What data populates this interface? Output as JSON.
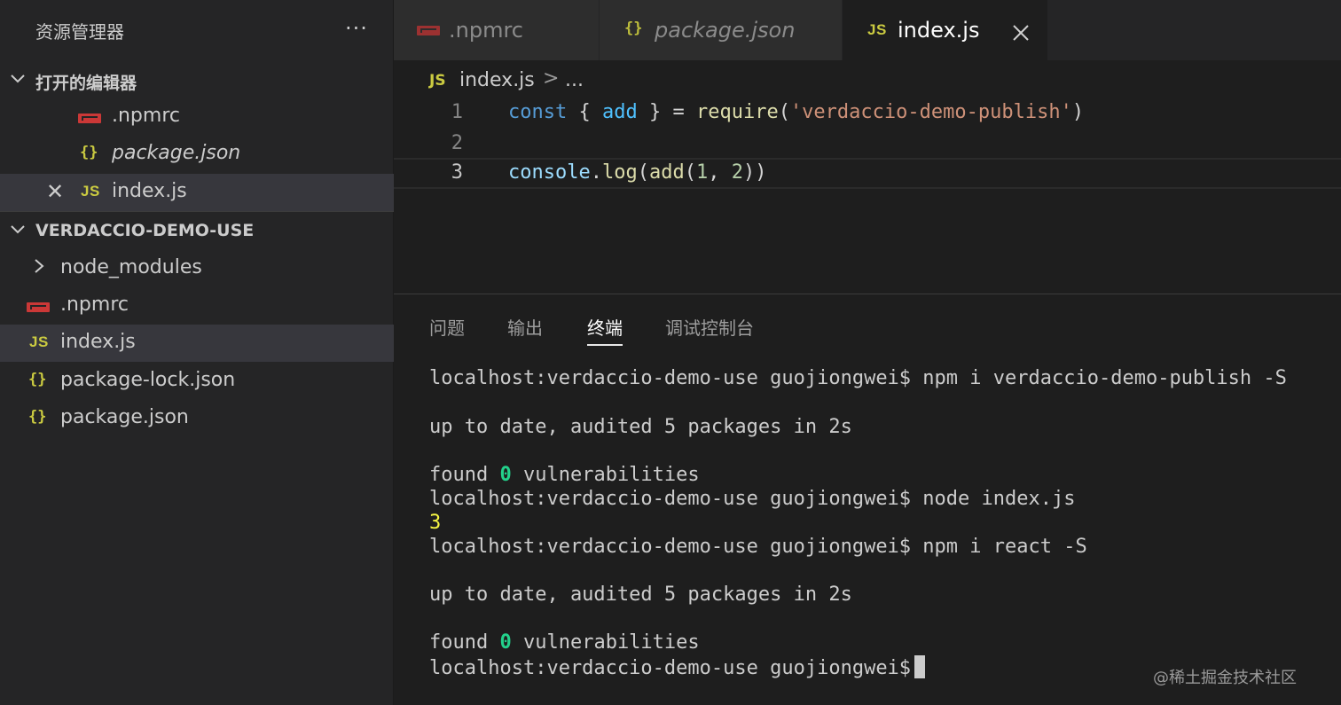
{
  "sidebar": {
    "title": "资源管理器",
    "more": "···",
    "open_editors": {
      "header": "打开的编辑器",
      "items": [
        {
          "label": ".npmrc",
          "icon": "npm-icon"
        },
        {
          "label": "package.json",
          "icon": "{}"
        },
        {
          "label": "index.js",
          "icon": "JS"
        }
      ]
    },
    "workspace": {
      "header": "VERDACCIO-DEMO-USE",
      "items": [
        {
          "label": "node_modules",
          "type": "folder"
        },
        {
          "label": ".npmrc",
          "icon": "npm-icon"
        },
        {
          "label": "index.js",
          "icon": "JS"
        },
        {
          "label": "package-lock.json",
          "icon": "{}"
        },
        {
          "label": "package.json",
          "icon": "{}"
        }
      ]
    }
  },
  "tabs": [
    {
      "label": ".npmrc",
      "icon": "npm-icon",
      "active": false
    },
    {
      "label": "package.json",
      "icon": "{}",
      "active": false,
      "italic": true
    },
    {
      "label": "index.js",
      "icon": "JS",
      "active": true
    }
  ],
  "editor": {
    "breadcrumb": {
      "icon": "JS",
      "file": "index.js",
      "sep": ">",
      "more": "..."
    },
    "line_numbers": [
      "1",
      "2",
      "3"
    ],
    "line1": {
      "t1": "const",
      "t2": " { ",
      "t3": "add",
      "t4": " } = ",
      "t5": "require",
      "t6": "(",
      "t7": "'verdaccio-demo-publish'",
      "t8": ")"
    },
    "line3": {
      "t1": "console",
      "t2": ".",
      "t3": "log",
      "t4": "(",
      "t5": "add",
      "t6": "(",
      "t7": "1",
      "t8": ", ",
      "t9": "2",
      "t10": "))"
    }
  },
  "panel": {
    "tabs": [
      "问题",
      "输出",
      "终端",
      "调试控制台"
    ],
    "active_tab": "终端",
    "terminal": {
      "l1": "localhost:verdaccio-demo-use guojiongwei$ npm i verdaccio-demo-publish -S",
      "l2": "up to date, audited 5 packages in 2s",
      "l3_a": "found ",
      "l3_b": "0",
      "l3_c": " vulnerabilities",
      "l4": "localhost:verdaccio-demo-use guojiongwei$ node index.js",
      "l5": "3",
      "l6": "localhost:verdaccio-demo-use guojiongwei$ npm i react -S",
      "l7": "up to date, audited 5 packages in 2s",
      "l8_a": "found ",
      "l8_b": "0",
      "l8_c": " vulnerabilities",
      "l9": "localhost:verdaccio-demo-use guojiongwei$"
    },
    "watermark": "@稀土掘金技术社区"
  },
  "colors": {
    "sidebar_bg": "#252526",
    "editor_bg": "#1e1e1e",
    "selection": "#37373d",
    "js_icon": "#cbcb41",
    "npm_icon": "#cb3837",
    "terminal_green": "#23d18b",
    "terminal_yellow": "#f5f543"
  }
}
